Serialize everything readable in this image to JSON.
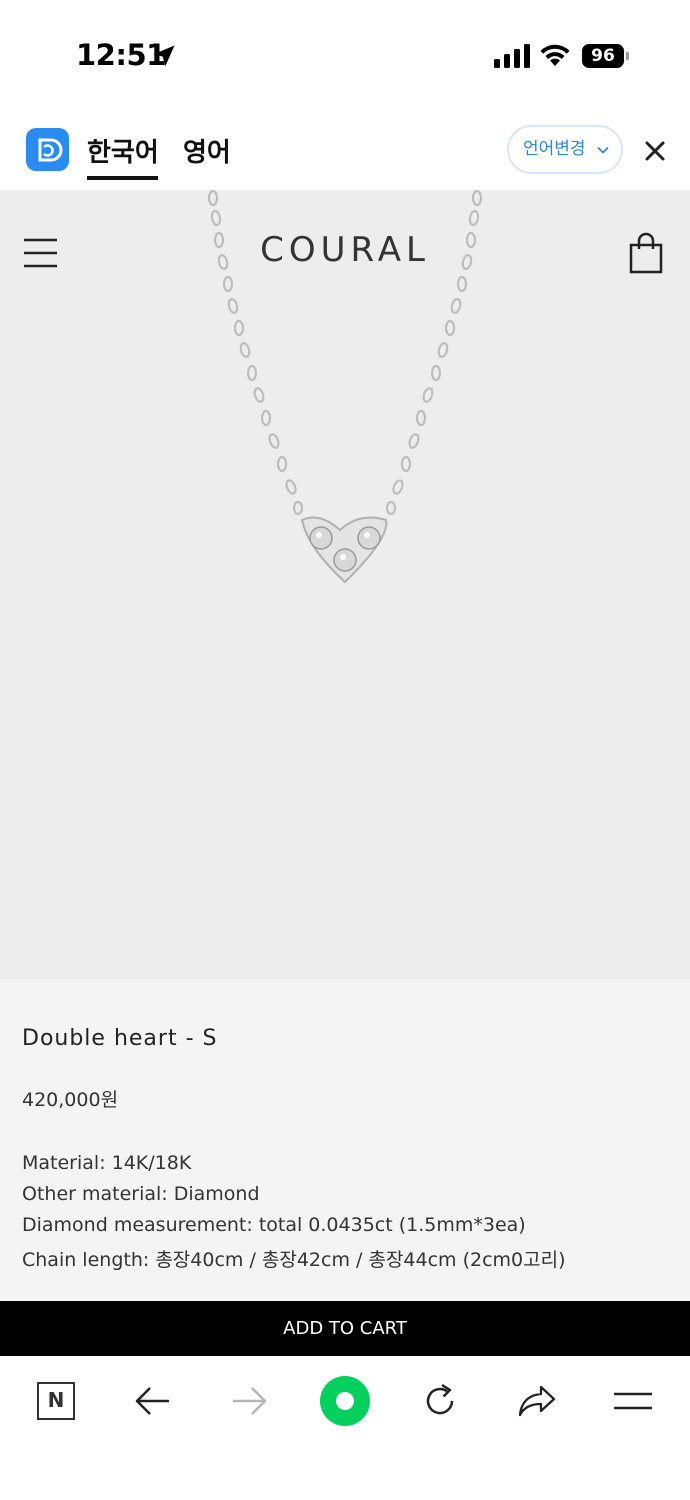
{
  "status_bar": {
    "time": "12:51",
    "battery": "96"
  },
  "translate_bar": {
    "tab_active": "한국어",
    "tab_target": "영어",
    "change_language": "언어변경"
  },
  "header": {
    "brand": "COURAL"
  },
  "product": {
    "title": "Double heart - S",
    "price": "420,000원",
    "specs": [
      "Material: 14K/18K",
      "Other material: Diamond",
      "Diamond measurement: total 0.0435ct (1.5mm*3ea)",
      "Chain length: 총장40cm / 총장42cm / 총장44cm (2cm0고리)"
    ]
  },
  "actions": {
    "add_to_cart": "ADD TO CART"
  },
  "browser_toolbar": {
    "naver_label": "N",
    "icons": [
      "naver-home-icon",
      "back-arrow-icon",
      "forward-arrow-icon",
      "green-dot-icon",
      "reload-icon",
      "share-icon",
      "menu-icon"
    ]
  },
  "colors": {
    "accent_blue": "#2e86de",
    "naver_green": "#03cf5d",
    "hero_bg": "#ededed",
    "cart_bg": "#000000"
  }
}
